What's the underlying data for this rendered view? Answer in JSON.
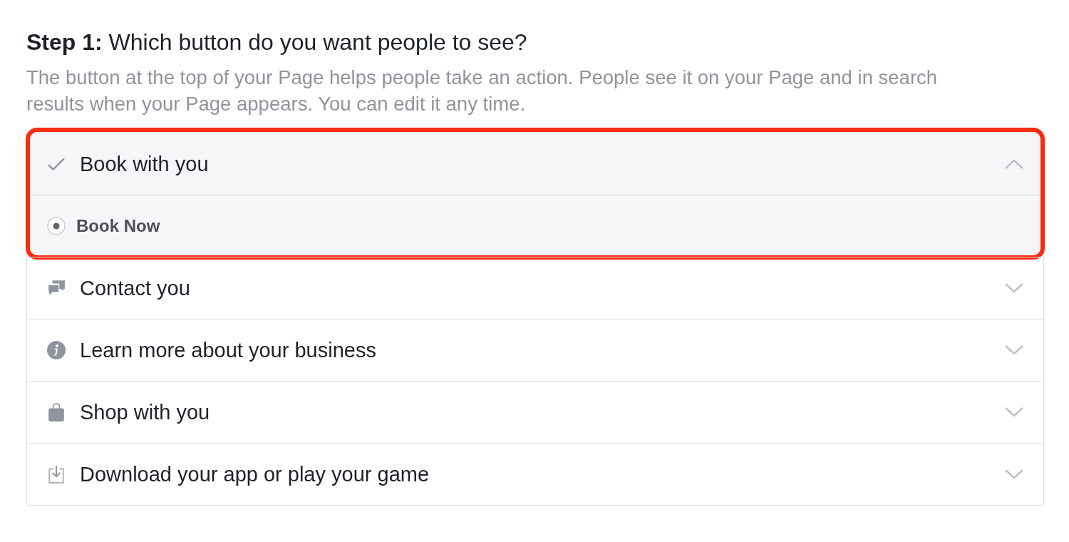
{
  "heading": "**Step 1:** Which button do you want people to see?",
  "description": "The button at the top of your Page helps people take an action. People see it on your Page and in search results when your Page appears. You can edit it any time.",
  "options": [
    {
      "label": "Book with you",
      "selected": true,
      "expanded": true,
      "highlighted": true,
      "choices": [
        {
          "label": "Book Now",
          "selected": true
        }
      ]
    },
    {
      "label": "Contact you",
      "selected": false,
      "expanded": false,
      "highlighted": false
    },
    {
      "label": "Learn more about your business",
      "selected": false,
      "expanded": false,
      "highlighted": false
    },
    {
      "label": "Shop with you",
      "selected": false,
      "expanded": false,
      "highlighted": false
    },
    {
      "label": "Download your app or play your game",
      "selected": false,
      "expanded": false,
      "highlighted": false
    }
  ]
}
